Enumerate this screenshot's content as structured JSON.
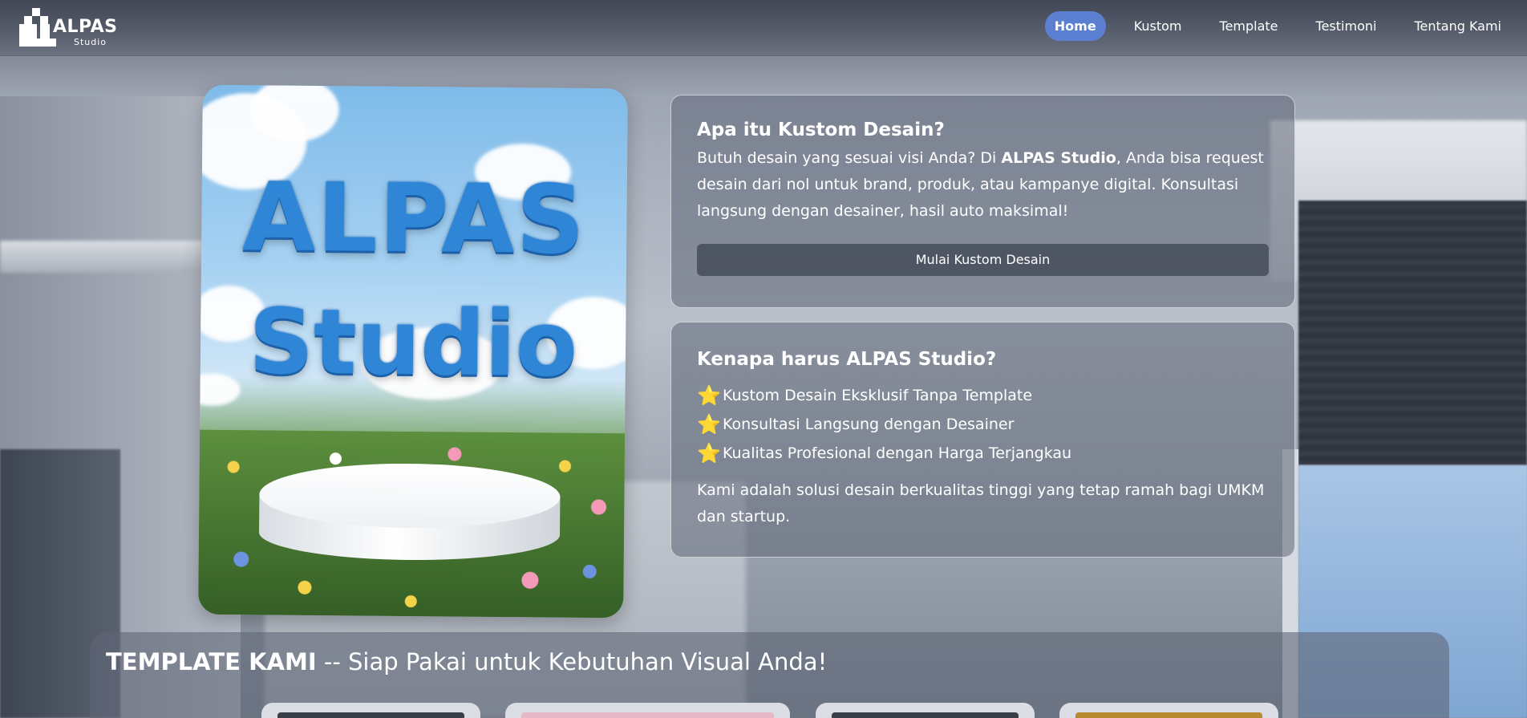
{
  "brand": {
    "name": "ALPAS",
    "sub": "Studio"
  },
  "nav": {
    "items": [
      {
        "label": "Home",
        "active": true
      },
      {
        "label": "Kustom"
      },
      {
        "label": "Template"
      },
      {
        "label": "Testimoni"
      },
      {
        "label": "Tentang Kami"
      }
    ]
  },
  "poster": {
    "line1": "ALPAS",
    "line2": "Studio"
  },
  "kustom": {
    "title": "Apa itu Kustom Desain?",
    "text_before": "Butuh desain yang sesuai visi Anda? Di ",
    "text_bold": "ALPAS Studio",
    "text_after": ", Anda bisa request desain dari nol untuk brand, produk, atau kampanye digital. Konsultasi langsung dengan desainer, hasil auto maksimal!",
    "cta": "Mulai Kustom Desain"
  },
  "why": {
    "title": "Kenapa harus ALPAS Studio?",
    "points": [
      "Kustom Desain Eksklusif Tanpa Template",
      "Konsultasi Langsung dengan Desainer",
      "Kualitas Profesional dengan Harga Terjangkau"
    ],
    "star": "⭐",
    "summary": "Kami adalah solusi desain berkualitas tinggi yang tetap ramah bagi UMKM dan startup."
  },
  "templates": {
    "heading_bold": "TEMPLATE KAMI",
    "heading_rest": " -- Siap Pakai untuk Kebutuhan Visual Anda!"
  },
  "colors": {
    "nav_active": "#5b7fd1",
    "star": "#f5c32c",
    "poster_text": "#2f86d6"
  }
}
